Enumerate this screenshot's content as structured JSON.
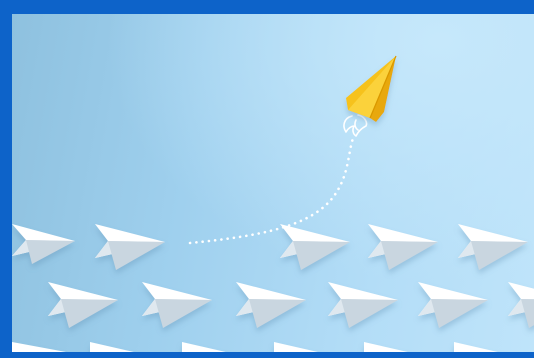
{
  "image": {
    "subject": "paper-planes",
    "colors": {
      "frame": "#0d63c9",
      "sky_light": "#c6e8fb",
      "sky_mid": "#a7d5f2",
      "sky_dark": "#8ec1df",
      "plane_white": "#ffffff",
      "plane_shade": "#dfe8ef",
      "plane_shadow": "#c9d6e0",
      "leader_plane": "#f6c21c",
      "leader_plane_shade": "#e8a807",
      "trail": "#ffffff"
    }
  }
}
